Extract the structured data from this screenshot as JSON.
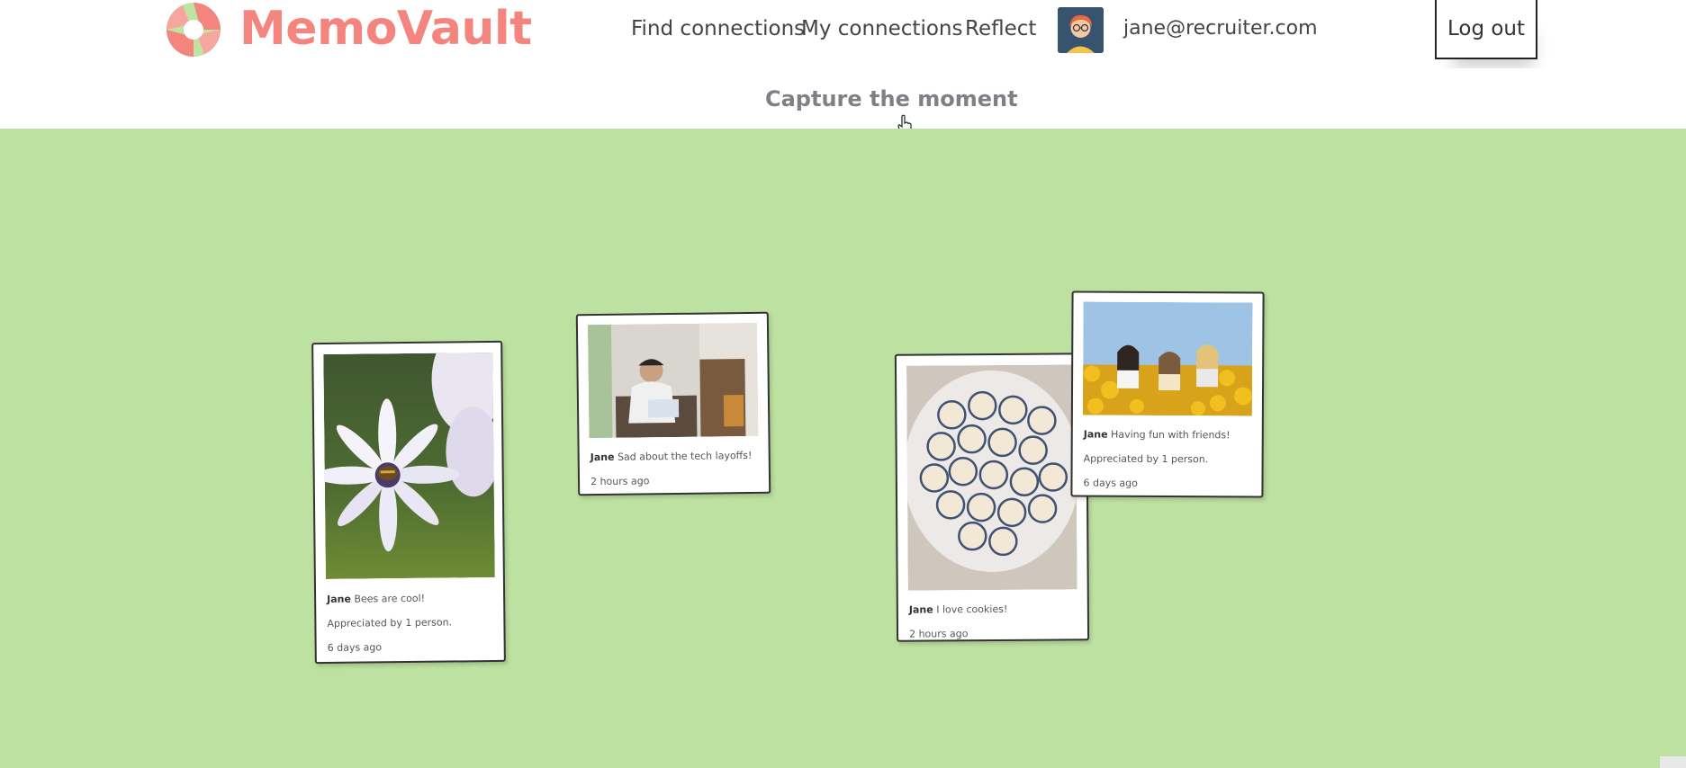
{
  "header": {
    "brand": "MemoVault",
    "nav": {
      "find": "Find connections",
      "mine": "My connections",
      "reflect": "Reflect"
    },
    "user_email": "jane@recruiter.com",
    "logout_label": "Log out",
    "accent_color": "#f4857e"
  },
  "subheader": {
    "capture_label": "Capture the moment"
  },
  "board": {
    "background": "#bce1a0",
    "cards": [
      {
        "author": "Jane",
        "caption": "Bees are cool!",
        "appreciation": "Appreciated by 1 person.",
        "time": "6 days ago",
        "photo": "bee-on-daisy"
      },
      {
        "author": "Jane",
        "caption": "Sad about the tech layoffs!",
        "appreciation": "",
        "time": "2 hours ago",
        "photo": "person-at-desk"
      },
      {
        "author": "Jane",
        "caption": "I love cookies!",
        "appreciation": "",
        "time": "2 hours ago",
        "photo": "plate-of-cookies"
      },
      {
        "author": "Jane",
        "caption": "Having fun with friends!",
        "appreciation": "Appreciated by 1 person.",
        "time": "6 days ago",
        "photo": "friends-in-sunflowers"
      }
    ]
  }
}
